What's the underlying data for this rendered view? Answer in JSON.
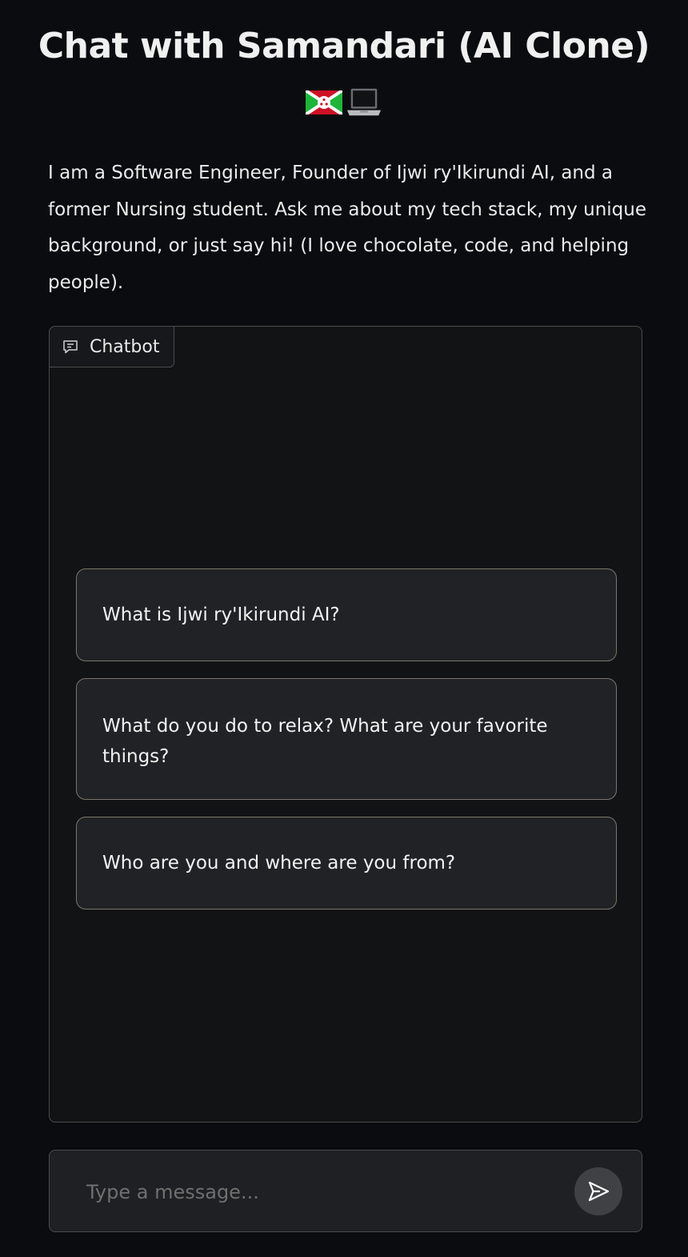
{
  "header": {
    "title": "Chat with Samandari (AI Clone)",
    "emojis": [
      "burundi-flag-icon",
      "laptop-icon"
    ]
  },
  "description": "I am a Software Engineer, Founder of Ijwi ry'Ikirundi AI, and a former Nursing student. Ask me about my tech stack, my unique background, or just say hi! (I love chocolate, code, and helping people).",
  "chatbot": {
    "label": "Chatbot",
    "icon": "chat-bubble-icon",
    "examples": [
      "What is Ijwi ry'Ikirundi AI?",
      "What do you do to relax? What are your favorite things?",
      "Who are you and where are you from?"
    ]
  },
  "composer": {
    "placeholder": "Type a message...",
    "value": "",
    "send_icon": "send-icon"
  },
  "colors": {
    "background": "#0b0c0f",
    "panel": "#121315",
    "example_bg": "#212225",
    "example_border": "#7b766d",
    "send_button": "#3f4144"
  }
}
